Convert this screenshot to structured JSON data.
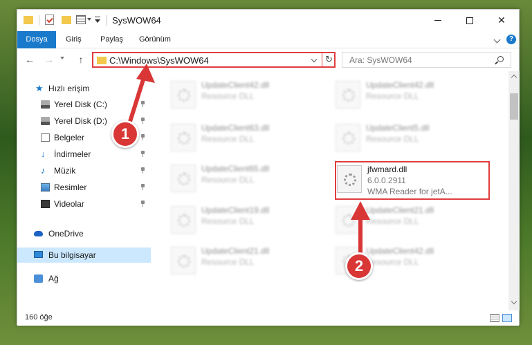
{
  "window": {
    "title": "SysWOW64"
  },
  "ribbon": {
    "tabs": [
      "Dosya",
      "Giriş",
      "Paylaş",
      "Görünüm"
    ]
  },
  "nav": {
    "address": "C:\\Windows\\SysWOW64",
    "search_placeholder": "Ara: SysWOW64"
  },
  "sidebar": {
    "items": [
      {
        "label": "Hızlı erişim",
        "icon": "star-icon"
      },
      {
        "label": "Yerel Disk (C:)",
        "icon": "drive-icon"
      },
      {
        "label": "Yerel Disk (D:)",
        "icon": "drive-icon"
      },
      {
        "label": "Belgeler",
        "icon": "documents-icon"
      },
      {
        "label": "İndirmeler",
        "icon": "download-icon"
      },
      {
        "label": "Müzik",
        "icon": "music-icon"
      },
      {
        "label": "Resimler",
        "icon": "pictures-icon"
      },
      {
        "label": "Videolar",
        "icon": "videos-icon"
      },
      {
        "label": "OneDrive",
        "icon": "onedrive-icon"
      },
      {
        "label": "Bu bilgisayar",
        "icon": "this-pc-icon"
      },
      {
        "label": "Ağ",
        "icon": "network-icon"
      }
    ]
  },
  "files": {
    "left": [
      {
        "name": "UpdateClient42.dll",
        "desc": "Resource DLL"
      },
      {
        "name": "UpdateClient63.dll",
        "desc": "Resource DLL"
      },
      {
        "name": "UpdateClient65.dll",
        "desc": "Resource DLL"
      },
      {
        "name": "UpdateClient19.dll",
        "desc": "Resource DLL"
      },
      {
        "name": "UpdateClient21.dll",
        "desc": "Resource DLL"
      }
    ],
    "right": [
      {
        "name": "UpdateClient42.dll",
        "desc": "Resource DLL"
      },
      {
        "name": "UpdateClient5.dll",
        "desc": "Resource DLL"
      },
      {
        "name": "UpdateClient21.dll",
        "desc": "Resource DLL"
      },
      {
        "name": "UpdateClient42.dll",
        "desc": "Resource DLL"
      }
    ],
    "highlighted": {
      "name": "jfwmard.dll",
      "version": "6.0.0.2911",
      "desc": "WMA Reader for jetA..."
    }
  },
  "status": {
    "count": "160 öğe"
  },
  "annotations": {
    "step1": "1",
    "step2": "2"
  },
  "colors": {
    "accent": "#1979ca",
    "annotation": "#d93636"
  }
}
